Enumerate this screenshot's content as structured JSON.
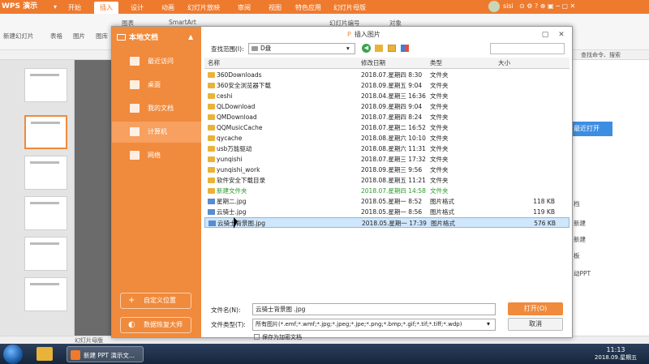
{
  "app": {
    "logo": "WPS 演示",
    "tabs": [
      "开始",
      "插入",
      "设计",
      "动画",
      "幻灯片放映",
      "审阅",
      "视图",
      "特色应用",
      "幻灯片母版"
    ],
    "active_tab": "插入",
    "user": "sisi",
    "ribbon": [
      "新建幻灯片",
      "表格",
      "图片",
      "图库",
      "图表",
      "SmartArt",
      "幻灯片编号",
      "对象"
    ],
    "right_toolbar": "查找命令、搜索",
    "right_pane": {
      "recent_label": "最近打开",
      "items": [
        "档",
        "新建",
        "新建",
        "板",
        "动PPT"
      ]
    },
    "status": "幻灯片母版",
    "clock": {
      "time": "11:13",
      "date": "2018.09.星期五"
    },
    "taskbar_item": "新建 PPT 演示文..."
  },
  "dialog": {
    "title": "插入图片",
    "left_panel": {
      "title": "本地文档",
      "nav": [
        "最近访问",
        "桌面",
        "我的文档",
        "计算机",
        "网络"
      ],
      "selected_nav": "计算机",
      "buttons": [
        "自定义位置",
        "数据恢复大师"
      ]
    },
    "look_in_label": "查找范围(I):",
    "look_in_value": "D盘",
    "columns": {
      "name": "名称",
      "date": "修改日期",
      "type": "类型",
      "size": "大小"
    },
    "files": [
      {
        "name": "360Downloads",
        "date": "2018.07.星期四 8:30",
        "type": "文件夹",
        "size": "",
        "kind": "folder"
      },
      {
        "name": "360安全浏览器下载",
        "date": "2018.09.星期五 9:04",
        "type": "文件夹",
        "size": "",
        "kind": "folder"
      },
      {
        "name": "ceshi",
        "date": "2018.04.星期三 16:36",
        "type": "文件夹",
        "size": "",
        "kind": "folder"
      },
      {
        "name": "QLDownload",
        "date": "2018.09.星期四 9:04",
        "type": "文件夹",
        "size": "",
        "kind": "folder"
      },
      {
        "name": "QMDownload",
        "date": "2018.07.星期四 8:24",
        "type": "文件夹",
        "size": "",
        "kind": "folder"
      },
      {
        "name": "QQMusicCache",
        "date": "2018.07.星期二 16:52",
        "type": "文件夹",
        "size": "",
        "kind": "folder"
      },
      {
        "name": "qycache",
        "date": "2018.08.星期六 10:10",
        "type": "文件夹",
        "size": "",
        "kind": "folder"
      },
      {
        "name": "usb万能驱动",
        "date": "2018.08.星期六 11:31",
        "type": "文件夹",
        "size": "",
        "kind": "folder"
      },
      {
        "name": "yunqishi",
        "date": "2018.07.星期三 17:32",
        "type": "文件夹",
        "size": "",
        "kind": "folder"
      },
      {
        "name": "yunqishi_work",
        "date": "2018.09.星期三 9:56",
        "type": "文件夹",
        "size": "",
        "kind": "folder"
      },
      {
        "name": "软件安全下载目录",
        "date": "2018.08.星期五 11:21",
        "type": "文件夹",
        "size": "",
        "kind": "folder"
      },
      {
        "name": "新建文件夹",
        "date": "2018.07.星期四 14:58",
        "type": "文件夹",
        "size": "",
        "kind": "folder",
        "color": "#2e9a2e"
      },
      {
        "name": "星期二.jpg",
        "date": "2018.05.星期一 8:52",
        "type": "图片格式",
        "size": "118 KB",
        "kind": "image"
      },
      {
        "name": "云骑士.jpg",
        "date": "2018.05.星期一 8:56",
        "type": "图片格式",
        "size": "119 KB",
        "kind": "image"
      },
      {
        "name": "云骑士背景图.jpg",
        "date": "2018.05.星期一 17:39",
        "type": "图片格式",
        "size": "576 KB",
        "kind": "image",
        "selected": true
      }
    ],
    "filename_label": "文件名(N):",
    "filename_value": "云骑士背景图 .jpg",
    "filetype_label": "文件类型(T):",
    "filetype_value": "所有图片(*.emf;*.wmf;*.jpg;*.jpeg;*.jpe;*.png;*.bmp;*.gif;*.tif;*.tiff;*.wdp)",
    "encrypt_label": "保存为加密文档",
    "open_label": "打开(O)",
    "cancel_label": "取消"
  }
}
